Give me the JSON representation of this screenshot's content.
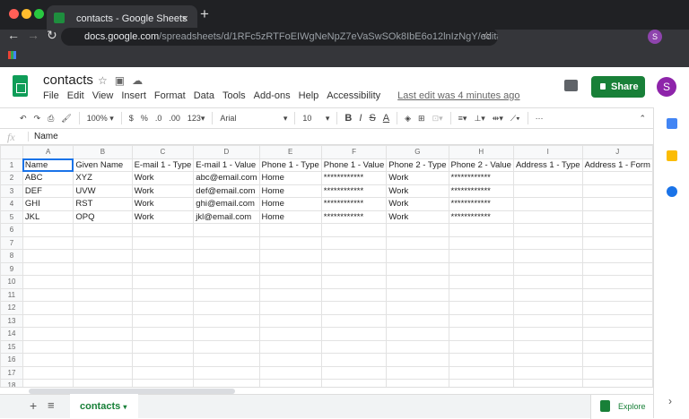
{
  "browser": {
    "tab_title": "contacts - Google Sheets",
    "url_host": "docs.google.com",
    "url_path": "/spreadsheets/d/1RFc5zRTFoEIWgNeNpZ7eVaSwSOk8IbE6o12lnIzNgY/edit#gi...",
    "profile": "S"
  },
  "doc": {
    "title": "contacts",
    "menu": [
      "File",
      "Edit",
      "View",
      "Insert",
      "Format",
      "Data",
      "Tools",
      "Add-ons",
      "Help",
      "Accessibility"
    ],
    "last_edit": "Last edit was 4 minutes ago",
    "share": "Share",
    "user": "S"
  },
  "toolbar": {
    "zoom": "100%",
    "currency": "$",
    "percent": "%",
    "dec_less": ".0",
    "dec_more": ".00",
    "format": "123",
    "font": "Arial",
    "size": "10",
    "bold": "B",
    "italic": "I",
    "strike": "S",
    "color": "A"
  },
  "formula": {
    "fx": "fx",
    "value": "Name"
  },
  "grid": {
    "columns": [
      "A",
      "B",
      "C",
      "D",
      "E",
      "F",
      "G",
      "H",
      "I",
      "J"
    ],
    "rows": [
      [
        "Name",
        "Given Name",
        "E-mail 1 - Type",
        "E-mail 1 - Value",
        "Phone 1 - Type",
        "Phone 1 - Value",
        "Phone 2 - Type",
        "Phone 2 - Value",
        "Address 1 - Type",
        "Address 1 - Form"
      ],
      [
        "ABC",
        "XYZ",
        "Work",
        "abc@email.com",
        "Home",
        "************",
        "Work",
        "************",
        "",
        ""
      ],
      [
        "DEF",
        "UVW",
        "Work",
        "def@email.com",
        "Home",
        "************",
        "Work",
        "************",
        "",
        ""
      ],
      [
        "GHI",
        "RST",
        "Work",
        "ghi@email.com",
        "Home",
        "************",
        "Work",
        "************",
        "",
        ""
      ],
      [
        "JKL",
        "OPQ",
        "Work",
        "jkl@email.com",
        "Home",
        "************",
        "Work",
        "************",
        "",
        ""
      ]
    ],
    "row_count": 18
  },
  "sheets": {
    "active": "contacts",
    "explore": "Explore"
  }
}
